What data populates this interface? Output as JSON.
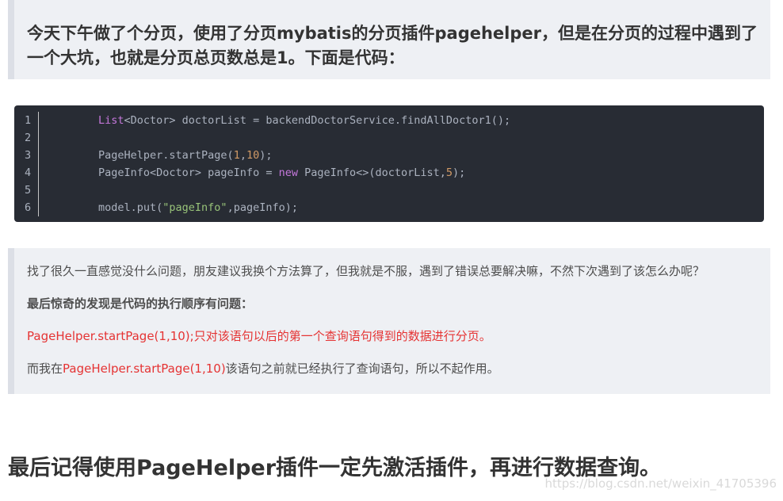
{
  "intro_quote": "今天下午做了个分页，使用了分页mybatis的分页插件pagehelper，但是在分页的过程中遇到了一个大坑，也就是分页总页数总是1。下面是代码：",
  "code_block": {
    "language": "java",
    "lines": [
      {
        "num": "1",
        "text": "List<Doctor> doctorList = backendDoctorService.findAllDoctor1();"
      },
      {
        "num": "2",
        "text": ""
      },
      {
        "num": "3",
        "text": "PageHelper.startPage(1,10);"
      },
      {
        "num": "4",
        "text": "PageInfo<Doctor> pageInfo = new PageInfo<>(doctorList,5);"
      },
      {
        "num": "5",
        "text": ""
      },
      {
        "num": "6",
        "text": "model.put(\"pageInfo\",pageInfo);"
      }
    ]
  },
  "explanation": {
    "paragraph1": "找了很久一直感觉没什么问题，朋友建议我换个方法算了，但我就是不服，遇到了错误总要解决嘛，不然下次遇到了该怎么办呢？",
    "paragraph2": "最后惊奇的发现是代码的执行顺序有问题：",
    "paragraph3": "PageHelper.startPage(1,10);只对该语句以后的第一个查询语句得到的数据进行分页。",
    "paragraph4": {
      "prefix": "而我在",
      "highlight": "PageHelper.startPage(1,10)",
      "suffix": "该语句之前就已经执行了查询语句，所以不起作用。"
    }
  },
  "final_heading": "最后记得使用PageHelper插件一定先激活插件，再进行数据查询。",
  "watermark": "https://blog.csdn.net/weixin_41705396",
  "colors": {
    "highlight_red": "#e53333",
    "code_bg": "#282c34",
    "quote_bg": "#eef0f4"
  }
}
